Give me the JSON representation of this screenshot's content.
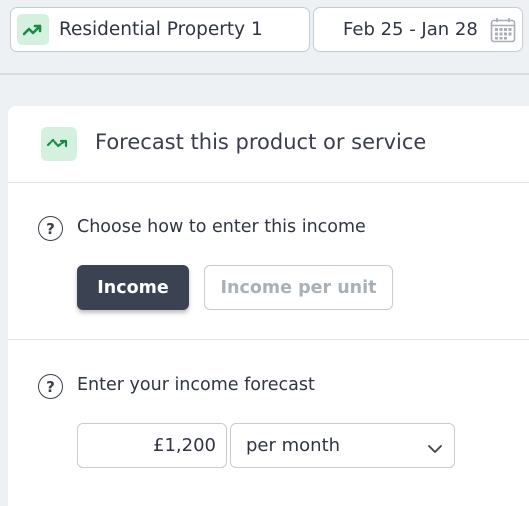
{
  "topbar": {
    "property": {
      "label": "Residential Property 1",
      "icon": "trend-up-icon"
    },
    "date_range": {
      "label": "Feb 25 - Jan 28",
      "icon": "calendar-icon"
    }
  },
  "panel": {
    "title": "Forecast this product or service",
    "icon": "forecast-trend-icon",
    "entry_method": {
      "question": "Choose how to enter this income",
      "options": [
        {
          "label": "Income",
          "selected": true
        },
        {
          "label": "Income per unit",
          "selected": false
        }
      ]
    },
    "forecast": {
      "question": "Enter your income forecast",
      "amount": "£1,200",
      "period": "per month"
    }
  },
  "colors": {
    "accent_green": "#1a8a45",
    "badge_bg": "#d4f0df",
    "selected_button": "#3b4352"
  }
}
